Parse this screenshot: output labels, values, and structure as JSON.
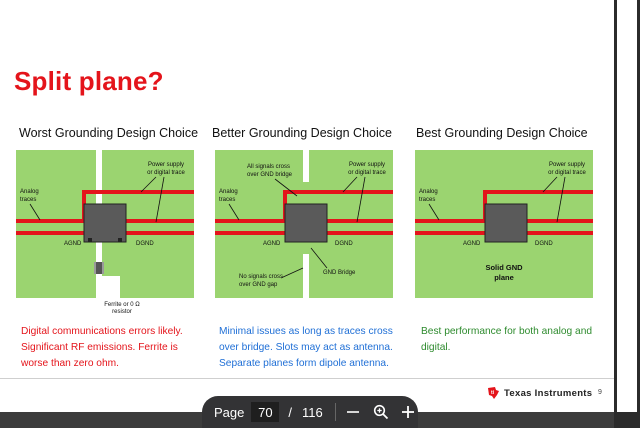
{
  "slide": {
    "title": "Split plane?",
    "columns": [
      {
        "heading": "Worst Grounding Design Choice",
        "labels": {
          "power": [
            "Power supply",
            "or digital trace"
          ],
          "analog": [
            "Analog",
            "traces"
          ],
          "agnd": "AGND",
          "dgnd": "DGND",
          "ferrite": [
            "Ferrite or 0 Ω",
            "resistor"
          ]
        },
        "caption": "Digital communications errors likely. Significant RF emissions.  Ferrite is worse than zero ohm."
      },
      {
        "heading": "Better Grounding Design Choice",
        "labels": {
          "cross": [
            "All signals cross",
            "over GND bridge"
          ],
          "power": [
            "Power supply",
            "or digital trace"
          ],
          "analog": [
            "Analog",
            "traces"
          ],
          "agnd": "AGND",
          "dgnd": "DGND",
          "bridge": "GND Bridge",
          "gap": [
            "No signals cross",
            "over GND gap"
          ]
        },
        "caption": "Minimal issues as long as traces cross over bridge.  Slots may act as antenna. Separate planes form dipole antenna."
      },
      {
        "heading": "Best Grounding Design Choice",
        "labels": {
          "power": [
            "Power supply",
            "or digital trace"
          ],
          "analog": [
            "Analog",
            "traces"
          ],
          "agnd": "AGND",
          "dgnd": "DGND",
          "solid": [
            "Solid GND",
            "plane"
          ]
        },
        "caption": "Best performance for both analog and digital."
      }
    ],
    "footer": {
      "company": "Texas Instruments",
      "slide_number": "9"
    }
  },
  "viewer": {
    "page_label": "Page",
    "current_page": "70",
    "separator": "/",
    "total_pages": "116"
  },
  "colors": {
    "title_red": "#e4141b",
    "plane_green": "#9bd470",
    "trace_red": "#e4141b",
    "chip_gray": "#555555",
    "caption_blue": "#1f6fd6",
    "caption_green": "#2e8b2e"
  }
}
